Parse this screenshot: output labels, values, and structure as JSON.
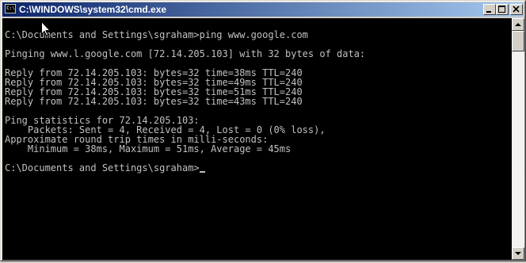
{
  "window": {
    "title": "C:\\WINDOWS\\system32\\cmd.exe",
    "icon_label": "C:\\",
    "controls": [
      "minimize-icon",
      "maximize-icon",
      "close-icon"
    ]
  },
  "console": {
    "lines": [
      "",
      "C:\\Documents and Settings\\sgraham>ping www.google.com",
      "",
      "Pinging www.l.google.com [72.14.205.103] with 32 bytes of data:",
      "",
      "Reply from 72.14.205.103: bytes=32 time=38ms TTL=240",
      "Reply from 72.14.205.103: bytes=32 time=49ms TTL=240",
      "Reply from 72.14.205.103: bytes=32 time=51ms TTL=240",
      "Reply from 72.14.205.103: bytes=32 time=43ms TTL=240",
      "",
      "Ping statistics for 72.14.205.103:",
      "    Packets: Sent = 4, Received = 4, Lost = 0 (0% loss),",
      "Approximate round trip times in milli-seconds:",
      "    Minimum = 38ms, Maximum = 51ms, Average = 45ms",
      "",
      "C:\\Documents and Settings\\sgraham>"
    ]
  },
  "colors": {
    "console_background": "#000000",
    "console_text": "#c0c0c0",
    "titlebar_start": "#0a246a",
    "titlebar_end": "#a6caf0"
  }
}
